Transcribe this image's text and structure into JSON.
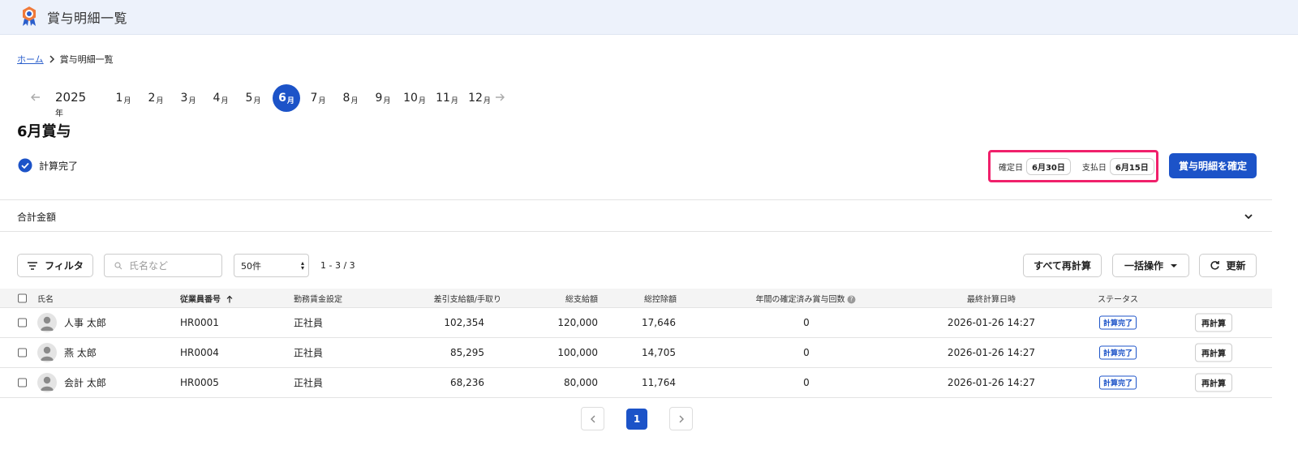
{
  "app": {
    "title": "賞与明細一覧",
    "logo_icon": "award-medal-icon"
  },
  "breadcrumb": {
    "home": "ホーム",
    "current": "賞与明細一覧"
  },
  "month_nav": {
    "year": "2025",
    "year_unit": "年",
    "month_unit": "月",
    "months": [
      "1",
      "2",
      "3",
      "4",
      "5",
      "6",
      "7",
      "8",
      "9",
      "10",
      "11",
      "12"
    ],
    "active": "6",
    "active_color": "#1c53c8"
  },
  "section": {
    "title": "6月賞与",
    "status_label": "計算完了"
  },
  "dates": {
    "confirm_label": "確定日",
    "confirm_value": "6月30日",
    "pay_label": "支払日",
    "pay_value": "6月15日",
    "highlight_color": "#f0206b"
  },
  "actions": {
    "confirm_button": "賞与明細を確定"
  },
  "totals": {
    "label": "合計金額"
  },
  "toolbar": {
    "filter": "フィルタ",
    "search_placeholder": "氏名など",
    "per_page": "50件",
    "count": "1 - 3 / 3",
    "recalc_all": "すべて再計算",
    "bulk": "一括操作",
    "refresh": "更新"
  },
  "table": {
    "headers": {
      "name": "氏名",
      "emp_no": "従業員番号",
      "wage": "勤務賃金設定",
      "net": "差引支給額/手取り",
      "gross": "総支給額",
      "deduct": "総控除額",
      "count": "年間の確定済み賞与回数",
      "calc_time": "最終計算日時",
      "status": "ステータス"
    },
    "rows": [
      {
        "name": "人事 太郎",
        "emp_no": "HR0001",
        "wage": "正社員",
        "net": "102,354",
        "gross": "120,000",
        "deduct": "17,646",
        "count": "0",
        "calc_time": "2026-01-26 14:27",
        "status": "計算完了",
        "action": "再計算"
      },
      {
        "name": "燕 太郎",
        "emp_no": "HR0004",
        "wage": "正社員",
        "net": "85,295",
        "gross": "100,000",
        "deduct": "14,705",
        "count": "0",
        "calc_time": "2026-01-26 14:27",
        "status": "計算完了",
        "action": "再計算"
      },
      {
        "name": "会計 太郎",
        "emp_no": "HR0005",
        "wage": "正社員",
        "net": "68,236",
        "gross": "80,000",
        "deduct": "11,764",
        "count": "0",
        "calc_time": "2026-01-26 14:27",
        "status": "計算完了",
        "action": "再計算"
      }
    ]
  },
  "pagination": {
    "current": "1"
  }
}
